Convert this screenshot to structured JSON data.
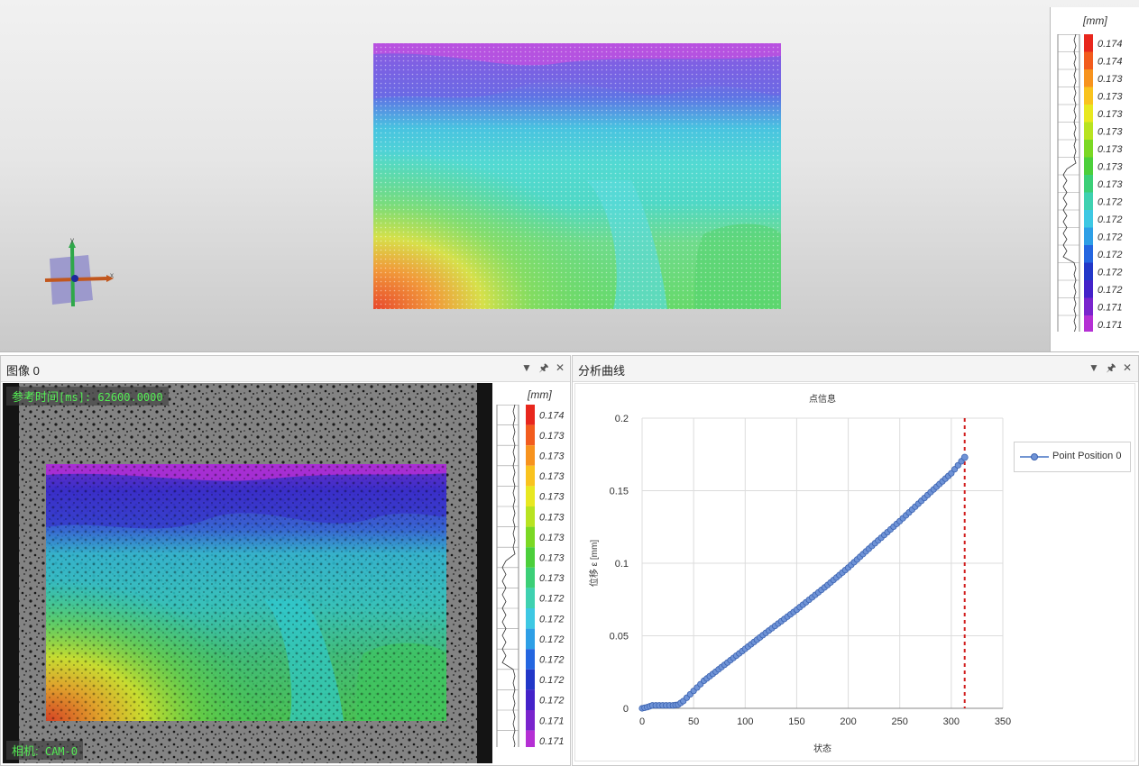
{
  "scale_legend": {
    "unit": "[mm]",
    "values": [
      "0.174",
      "0.174",
      "0.173",
      "0.173",
      "0.173",
      "0.173",
      "0.173",
      "0.173",
      "0.173",
      "0.172",
      "0.172",
      "0.172",
      "0.172",
      "0.172",
      "0.172",
      "0.171",
      "0.171"
    ],
    "colors": [
      "#e8271d",
      "#f25c1e",
      "#f7931e",
      "#f9c31f",
      "#e8e821",
      "#b8e321",
      "#7bd824",
      "#4ccf3b",
      "#3ccf77",
      "#3fd1b0",
      "#3ec8e3",
      "#2e9fe6",
      "#2466e0",
      "#2237c8",
      "#4422c9",
      "#7a24cd",
      "#b530d4"
    ]
  },
  "image_panel": {
    "title": "图像 0",
    "ref_time_label": "参考时间",
    "ref_time_value": "[ms]: 62600.0000",
    "camera_label": "相机:",
    "camera_value": "CAM-0",
    "values": [
      "0.174",
      "0.173",
      "0.173",
      "0.173",
      "0.173",
      "0.173",
      "0.173",
      "0.173",
      "0.173",
      "0.172",
      "0.172",
      "0.172",
      "0.172",
      "0.172",
      "0.172",
      "0.171",
      "0.171"
    ]
  },
  "chart_panel": {
    "title": "分析曲线",
    "legend_label": "Point Position 0"
  },
  "axes_glyph": {
    "x_label": "x",
    "y_label": "y"
  },
  "chart_data": {
    "type": "line",
    "title": "点信息",
    "xlabel": "状态",
    "ylabel": "位移 ε [mm]",
    "xlim": [
      0,
      350
    ],
    "ylim": [
      0,
      0.2
    ],
    "x_ticks": [
      "0",
      "50",
      "100",
      "150",
      "200",
      "250",
      "300",
      "350"
    ],
    "y_ticks": [
      "0",
      "0.05",
      "0.1",
      "0.15",
      "0.2"
    ],
    "series": [
      {
        "name": "Point Position 0",
        "x": [
          0,
          5,
          10,
          20,
          30,
          35,
          40,
          50,
          60,
          80,
          100,
          120,
          150,
          180,
          200,
          220,
          250,
          280,
          300,
          313
        ],
        "y": [
          0,
          0.0008,
          0.002,
          0.002,
          0.002,
          0.0025,
          0.005,
          0.012,
          0.019,
          0.03,
          0.041,
          0.052,
          0.068,
          0.085,
          0.097,
          0.11,
          0.129,
          0.149,
          0.162,
          0.173
        ]
      }
    ],
    "marker_line_x": 313,
    "grid": true,
    "legend_position": "top-right"
  }
}
